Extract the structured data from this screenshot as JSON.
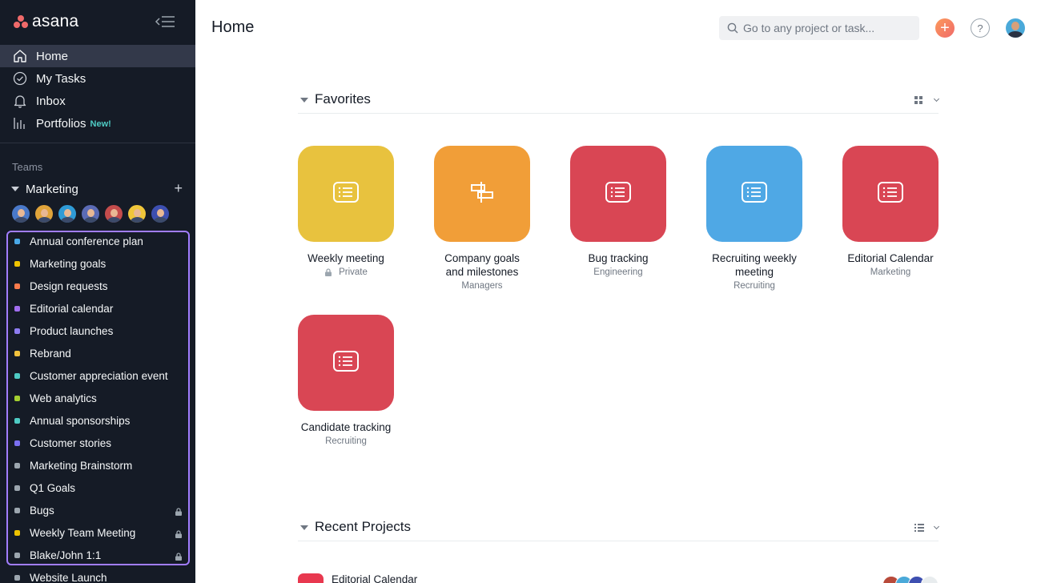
{
  "app": {
    "brand": "asana"
  },
  "nav": {
    "items": [
      {
        "label": "Home",
        "icon": "home-icon",
        "active": true
      },
      {
        "label": "My Tasks",
        "icon": "check-circle-icon",
        "active": false
      },
      {
        "label": "Inbox",
        "icon": "bell-icon",
        "active": false
      },
      {
        "label": "Portfolios",
        "icon": "bar-chart-icon",
        "active": false,
        "badge": "New!"
      }
    ]
  },
  "teams": {
    "heading": "Teams",
    "team_name": "Marketing",
    "member_colors": [
      "#4a79c9",
      "#e0a43a",
      "#2f9bd6",
      "#5b6bb5",
      "#c44c4c",
      "#f0c63a",
      "#3d4fb0"
    ]
  },
  "projects": [
    {
      "name": "Annual conference plan",
      "color": "#4aa9e8",
      "locked": false
    },
    {
      "name": "Marketing goals",
      "color": "#eec300",
      "locked": false
    },
    {
      "name": "Design requests",
      "color": "#fc7b4c",
      "locked": false
    },
    {
      "name": "Editorial calendar",
      "color": "#a16ef0",
      "locked": false
    },
    {
      "name": "Product launches",
      "color": "#8d7cf0",
      "locked": false
    },
    {
      "name": "Rebrand",
      "color": "#f1c23d",
      "locked": false
    },
    {
      "name": "Customer appreciation event",
      "color": "#4ecbc4",
      "locked": false
    },
    {
      "name": "Web analytics",
      "color": "#a4cf30",
      "locked": false
    },
    {
      "name": "Annual sponsorships",
      "color": "#4ecbc4",
      "locked": false
    },
    {
      "name": "Customer stories",
      "color": "#7a6ff0",
      "locked": false
    },
    {
      "name": "Marketing Brainstorm",
      "color": "#9ca6af",
      "locked": false
    },
    {
      "name": "Q1 Goals",
      "color": "#9ca6af",
      "locked": false
    },
    {
      "name": "Bugs",
      "color": "#9ca6af",
      "locked": true
    },
    {
      "name": "Weekly Team Meeting",
      "color": "#eec300",
      "locked": true
    },
    {
      "name": "Blake/John 1:1",
      "color": "#9ca6af",
      "locked": true
    },
    {
      "name": "Website Launch",
      "color": "#9ca6af",
      "locked": false
    }
  ],
  "header": {
    "title": "Home",
    "search_placeholder": "Go to any project or task..."
  },
  "favorites": {
    "title": "Favorites",
    "tiles": [
      {
        "name": "Weekly meeting",
        "sub": "Private",
        "color": "#e8c23e",
        "icon": "list-icon",
        "private": true
      },
      {
        "name": "Company goals and milestones",
        "sub": "Managers",
        "color": "#f19e38",
        "icon": "signpost-icon",
        "private": false
      },
      {
        "name": "Bug tracking",
        "sub": "Engineering",
        "color": "#d94654",
        "icon": "list-icon",
        "private": false
      },
      {
        "name": "Recruiting weekly meeting",
        "sub": "Recruiting",
        "color": "#4fa8e5",
        "icon": "list-icon",
        "private": false
      },
      {
        "name": "Editorial Calendar",
        "sub": "Marketing",
        "color": "#d94654",
        "icon": "list-icon",
        "private": false
      },
      {
        "name": "Candidate tracking",
        "sub": "Recruiting",
        "color": "#d94654",
        "icon": "list-icon",
        "private": false
      }
    ]
  },
  "recent": {
    "title": "Recent Projects",
    "items": [
      {
        "name": "Editorial Calendar",
        "color": "#e8384f"
      }
    ]
  }
}
